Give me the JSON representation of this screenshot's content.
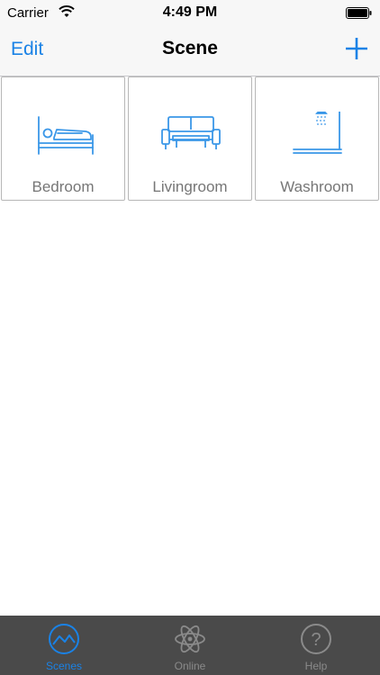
{
  "status_bar": {
    "carrier": "Carrier",
    "time": "4:49 PM"
  },
  "nav": {
    "edit_label": "Edit",
    "title": "Scene"
  },
  "scenes": [
    {
      "label": "Bedroom",
      "icon": "bed-icon"
    },
    {
      "label": "Livingroom",
      "icon": "sofa-icon"
    },
    {
      "label": "Washroom",
      "icon": "shower-icon"
    }
  ],
  "tabs": [
    {
      "label": "Scenes",
      "icon": "scenes-icon",
      "active": true
    },
    {
      "label": "Online",
      "icon": "atom-icon",
      "active": false
    },
    {
      "label": "Help",
      "icon": "help-icon",
      "active": false
    }
  ],
  "colors": {
    "accent": "#1a82e6",
    "tab_inactive": "#8a8a8a",
    "tab_bar_bg": "#4a4a4a"
  }
}
